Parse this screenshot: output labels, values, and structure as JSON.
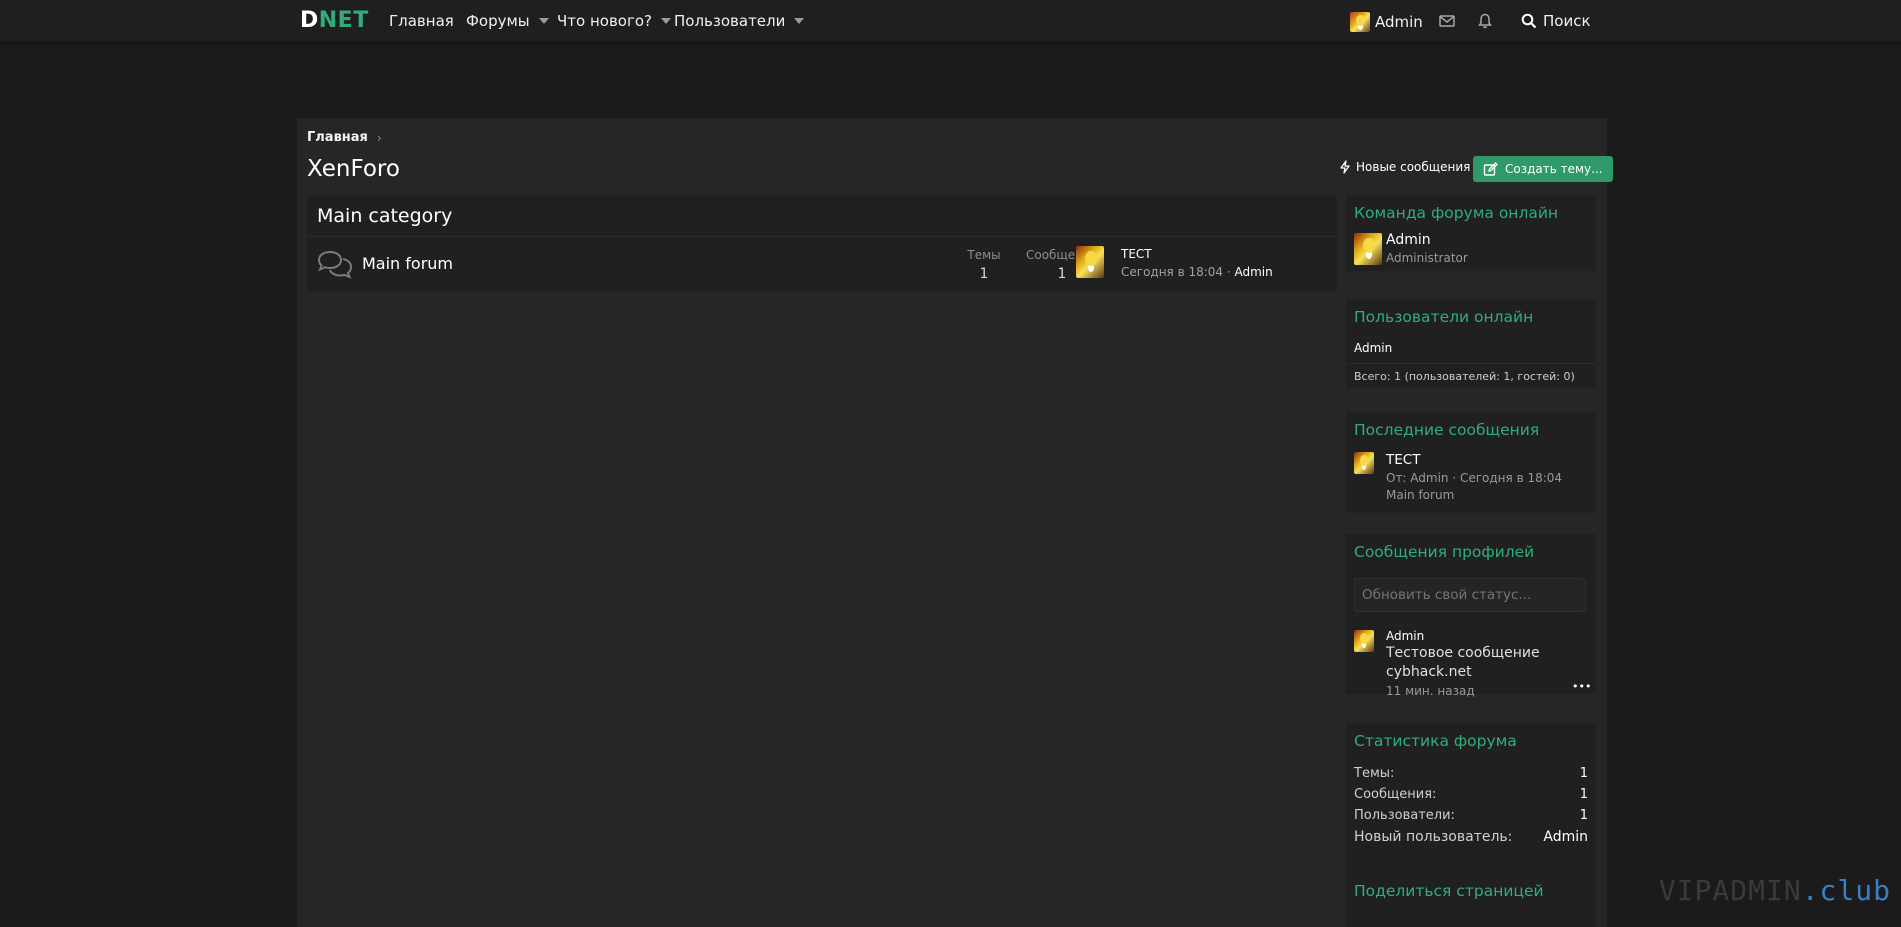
{
  "nav": {
    "logo_part1": "D",
    "logo_part2": "NET",
    "home": "Главная",
    "forums": "Форумы",
    "whats_new": "Что нового?",
    "users": "Пользователи",
    "account": "Admin",
    "search": "Поиск"
  },
  "breadcrumb": {
    "home": "Главная"
  },
  "page": {
    "title": "XenForo",
    "new_posts": "Новые сообщения",
    "create_thread": "Создать тему..."
  },
  "category": {
    "title": "Main category",
    "forum": {
      "title": "Main forum",
      "threads_label": "Темы",
      "threads_value": "1",
      "messages_label": "Сообщения",
      "messages_value": "1",
      "last_title": "ТЕСТ",
      "last_date": "Сегодня в 18:04 · ",
      "last_user": "Admin"
    }
  },
  "sidebar": {
    "staff": {
      "title": "Команда форума онлайн",
      "name": "Admin",
      "role": "Administrator"
    },
    "online": {
      "title": "Пользователи онлайн",
      "user": "Admin",
      "total": "Всего: 1 (пользователей: 1, гостей: 0)"
    },
    "latest": {
      "title": "Последние сообщения",
      "thread": "ТЕСТ",
      "meta": "От: Admin · Сегодня в 18:04",
      "forum": "Main forum"
    },
    "profile_posts": {
      "title": "Сообщения профилей",
      "placeholder": "Обновить свой статус...",
      "user": "Admin",
      "text_line1": "Тестовое сообщение",
      "text_line2": "cybhack.net",
      "time": "11 мин. назад",
      "more": "•••"
    },
    "stats": {
      "title": "Статистика форума",
      "threads_label": "Темы:",
      "threads": "1",
      "messages_label": "Сообщения:",
      "messages": "1",
      "members_label": "Пользователи:",
      "members": "1",
      "newest_label": "Новый пользователь:",
      "newest": "Admin"
    },
    "share": {
      "title": "Поделиться страницей"
    }
  },
  "watermark": {
    "part1": "VIPADMIN",
    "part2": ".club"
  },
  "colors": {
    "accent": "#2fae7a",
    "button": "#2e9a6c",
    "background": "#1b1b1b",
    "panel": "#262626"
  }
}
